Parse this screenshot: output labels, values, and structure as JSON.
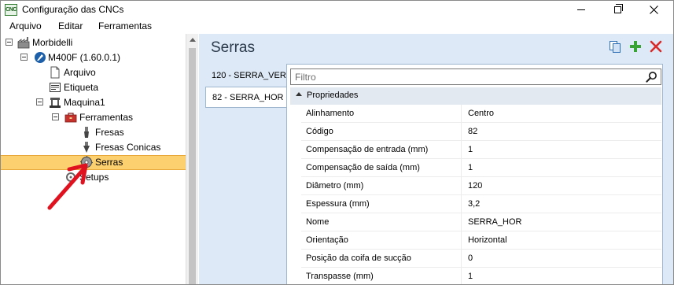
{
  "window": {
    "title": "Configuração das CNCs",
    "app_icon_text": "CNC"
  },
  "menu": [
    "Arquivo",
    "Editar",
    "Ferramentas"
  ],
  "tree": {
    "root": "Morbidelli",
    "machine": "M400F (1.60.0.1)",
    "arquivo": "Arquivo",
    "etiqueta": "Etiqueta",
    "maquina": "Maquina1",
    "ferramentas": "Ferramentas",
    "fresas": "Fresas",
    "fresas_conicas": "Fresas Conicas",
    "serras": "Serras",
    "setups": "Setups"
  },
  "panel": {
    "title": "Serras",
    "tabs": [
      "120 - SERRA_VER",
      "82 - SERRA_HOR"
    ],
    "active_tab": "82 - SERRA_HOR",
    "filter_placeholder": "Filtro",
    "category": "Propriedades"
  },
  "properties": [
    {
      "name": "Alinhamento",
      "value": "Centro"
    },
    {
      "name": "Código",
      "value": "82"
    },
    {
      "name": "Compensação de entrada (mm)",
      "value": "1"
    },
    {
      "name": "Compensação de saída (mm)",
      "value": "1"
    },
    {
      "name": "Diâmetro (mm)",
      "value": "120"
    },
    {
      "name": "Espessura (mm)",
      "value": "3,2"
    },
    {
      "name": "Nome",
      "value": "SERRA_HOR"
    },
    {
      "name": "Orientação",
      "value": "Horizontal"
    },
    {
      "name": "Posição da coifa de sucção",
      "value": "0"
    },
    {
      "name": "Transpasse (mm)",
      "value": "1"
    }
  ],
  "colors": {
    "selection": "#fccf6f",
    "panel_bg": "#dde9f7",
    "annotation_arrow": "#e0121f",
    "add_button": "#3aa335",
    "delete_button": "#d92a2a"
  }
}
